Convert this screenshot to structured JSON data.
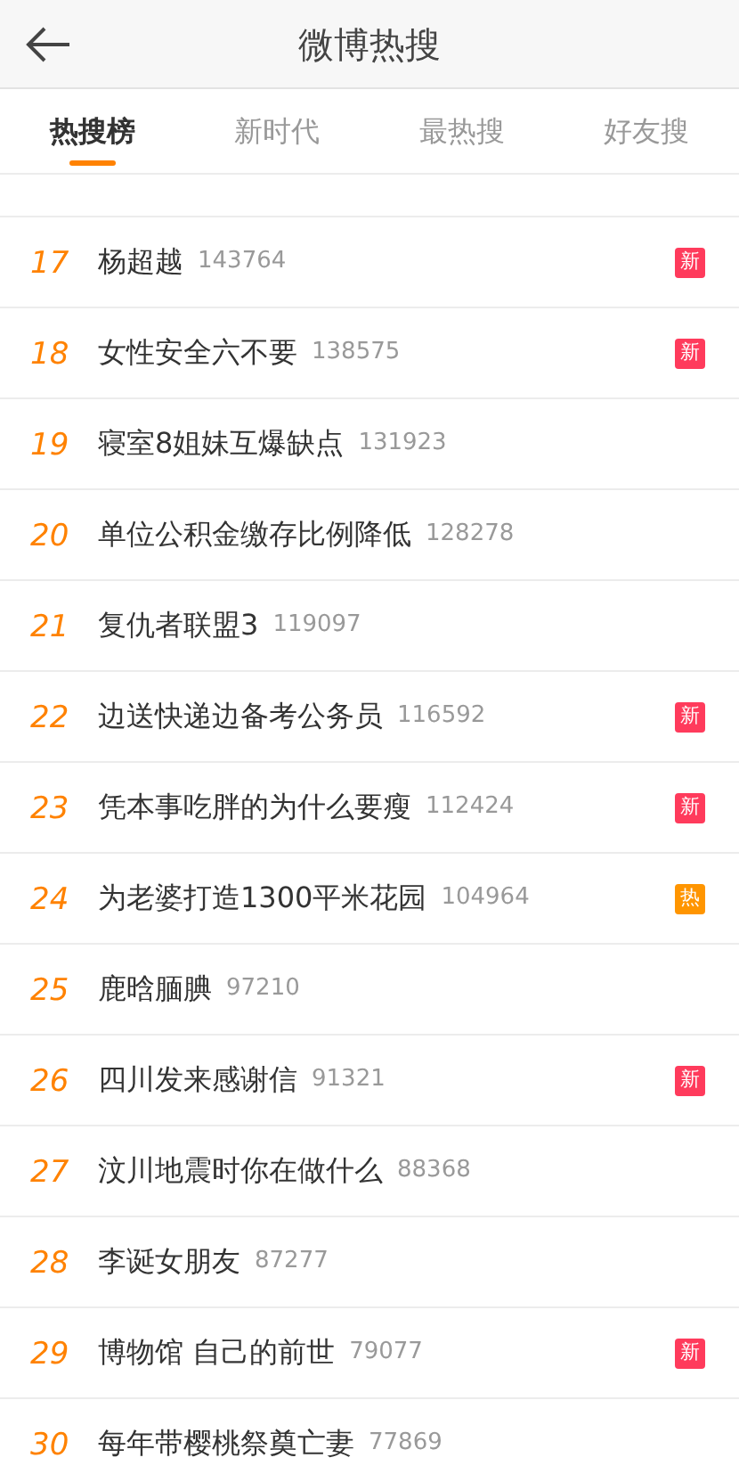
{
  "header": {
    "title": "微博热搜"
  },
  "tabs": [
    {
      "label": "热搜榜",
      "selected": true
    },
    {
      "label": "新时代",
      "selected": false
    },
    {
      "label": "最热搜",
      "selected": false
    },
    {
      "label": "好友搜",
      "selected": false
    }
  ],
  "rows": [
    {
      "rank": "17",
      "title": "杨超越",
      "count": "143764",
      "badge": {
        "kind": "new",
        "text": "新"
      }
    },
    {
      "rank": "18",
      "title": "女性安全六不要",
      "count": "138575",
      "badge": {
        "kind": "new",
        "text": "新"
      }
    },
    {
      "rank": "19",
      "title": "寝室8姐妹互爆缺点",
      "count": "131923"
    },
    {
      "rank": "20",
      "title": "单位公积金缴存比例降低",
      "count": "128278"
    },
    {
      "rank": "21",
      "title": "复仇者联盟3",
      "count": "119097"
    },
    {
      "rank": "22",
      "title": "边送快递边备考公务员",
      "count": "116592",
      "badge": {
        "kind": "new",
        "text": "新"
      }
    },
    {
      "rank": "23",
      "title": "凭本事吃胖的为什么要瘦",
      "count": "112424",
      "badge": {
        "kind": "new",
        "text": "新"
      }
    },
    {
      "rank": "24",
      "title": "为老婆打造1300平米花园",
      "count": "104964",
      "badge": {
        "kind": "hot",
        "text": "热"
      }
    },
    {
      "rank": "25",
      "title": "鹿晗腼腆",
      "count": "97210"
    },
    {
      "rank": "26",
      "title": "四川发来感谢信",
      "count": "91321",
      "badge": {
        "kind": "new",
        "text": "新"
      }
    },
    {
      "rank": "27",
      "title": "汶川地震时你在做什么",
      "count": "88368"
    },
    {
      "rank": "28",
      "title": "李诞女朋友",
      "count": "87277"
    },
    {
      "rank": "29",
      "title": "博物馆 自己的前世",
      "count": "79077",
      "badge": {
        "kind": "new",
        "text": "新"
      }
    },
    {
      "rank": "30",
      "title": "每年带樱桃祭奠亡妻",
      "count": "77869"
    }
  ]
}
